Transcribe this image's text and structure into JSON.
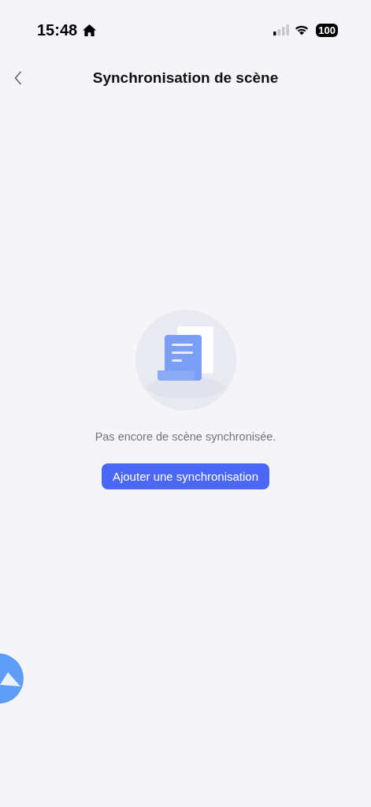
{
  "status_bar": {
    "time": "15:48",
    "battery": "100"
  },
  "nav": {
    "title": "Synchronisation de scène"
  },
  "empty_state": {
    "message": "Pas encore de scène synchronisée.",
    "button": "Ajouter une synchronisation"
  }
}
